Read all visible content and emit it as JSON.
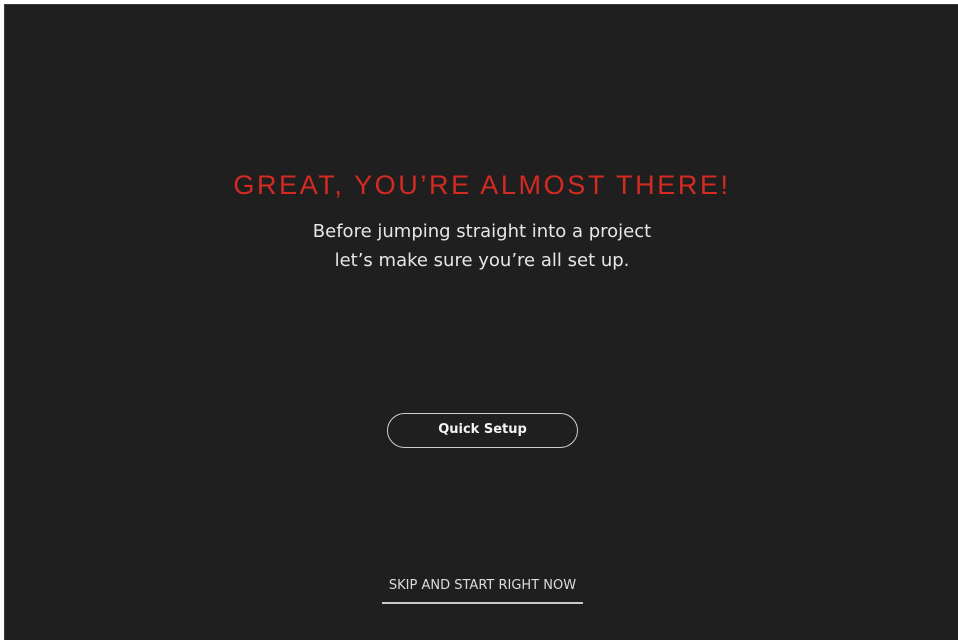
{
  "welcome": {
    "headline": "GREAT, YOU’RE ALMOST THERE!",
    "subtext_line1": "Before jumping straight into a project",
    "subtext_line2": "let’s make sure you’re all set up."
  },
  "actions": {
    "quick_setup_label": "Quick Setup",
    "skip_label": "SKIP AND START RIGHT NOW"
  },
  "colors": {
    "background": "#1f1f1f",
    "accent": "#d42a22",
    "text": "#e6e6e6"
  }
}
